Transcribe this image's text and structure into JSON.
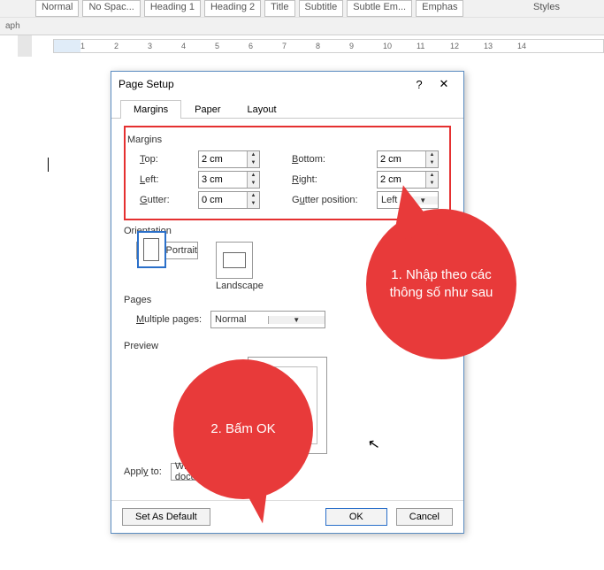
{
  "ribbon": {
    "styles": [
      "Normal",
      "No Spac...",
      "Heading 1",
      "Heading 2",
      "Title",
      "Subtitle",
      "Subtle Em...",
      "Emphas"
    ],
    "group_label": "Styles",
    "paragraph_tail": "aph"
  },
  "ruler": {
    "nums": [
      1,
      2,
      3,
      4,
      5,
      6,
      7,
      8,
      9,
      10,
      11,
      12,
      13,
      14
    ]
  },
  "dialog": {
    "title": "Page Setup",
    "help": "?",
    "close": "✕",
    "tabs": {
      "margins": "Margins",
      "paper": "Paper",
      "layout": "Layout"
    },
    "sect_margins": "Margins",
    "top_lbl": "Top:",
    "top_val": "2 cm",
    "bottom_lbl": "Bottom:",
    "bottom_val": "2 cm",
    "left_lbl": "Left:",
    "left_val": "3 cm",
    "right_lbl": "Right:",
    "right_val": "2 cm",
    "gutter_lbl": "Gutter:",
    "gutter_val": "0 cm",
    "gutterpos_lbl": "Gutter position:",
    "gutterpos_val": "Left",
    "sect_orient": "Orientation",
    "portrait": "Portrait",
    "landscape": "Landscape",
    "sect_pages": "Pages",
    "mult_lbl": "Multiple pages:",
    "mult_val": "Normal",
    "sect_preview": "Preview",
    "apply_lbl": "Apply to:",
    "apply_val": "Whole document",
    "set_default": "Set As Default",
    "ok": "OK",
    "cancel": "Cancel"
  },
  "callouts": {
    "c1": "1. Nhập theo các thông số như sau",
    "c2": "2. Bấm OK"
  }
}
